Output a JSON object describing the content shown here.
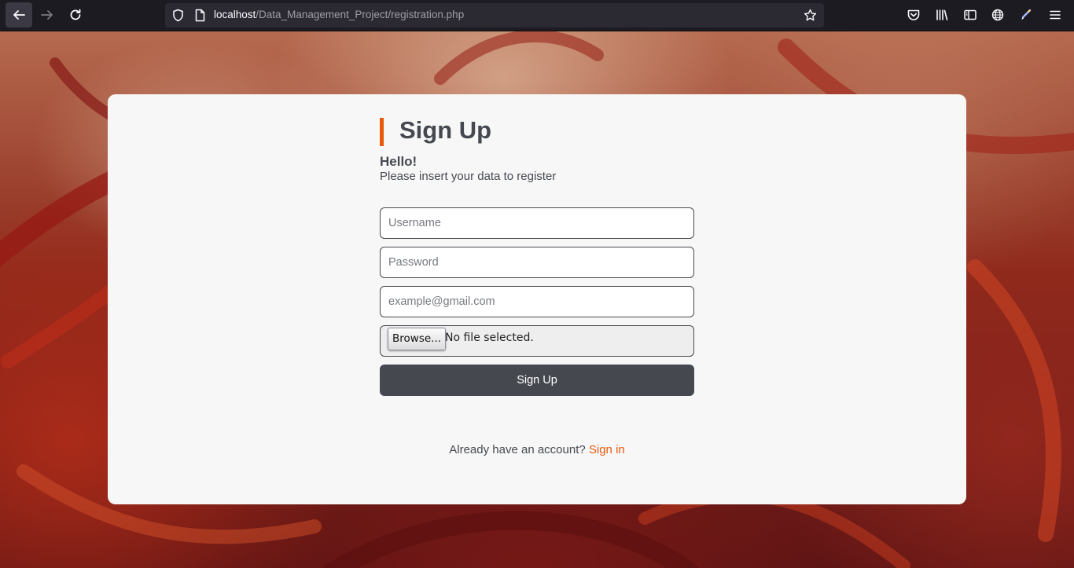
{
  "browser": {
    "url_host": "localhost",
    "url_path": "/Data_Management_Project/registration.php",
    "icons": {
      "back": "arrow-left-icon",
      "forward": "arrow-right-icon",
      "reload": "reload-icon",
      "tracking_protection": "shield-icon",
      "page_info": "page-icon",
      "bookmark": "star-icon",
      "pocket": "pocket-icon",
      "library": "library-icon",
      "sidebar": "sidebar-icon",
      "extension_globe": "globe-icon",
      "extension_pen": "pen-icon",
      "menu": "hamburger-menu-icon"
    }
  },
  "form": {
    "title": "Sign Up",
    "greeting": "Hello!",
    "subtitle": "Please insert your data to register",
    "username_placeholder": "Username",
    "password_placeholder": "Password",
    "email_placeholder": "example@gmail.com",
    "browse_label": "Browse...",
    "file_status": "No file selected.",
    "submit_label": "Sign Up",
    "footer_text": "Already have an account?",
    "signin_link": "Sign in"
  },
  "colors": {
    "accent": "#e8590c",
    "dark": "#45494f",
    "card_background": "#f7f7f7"
  }
}
